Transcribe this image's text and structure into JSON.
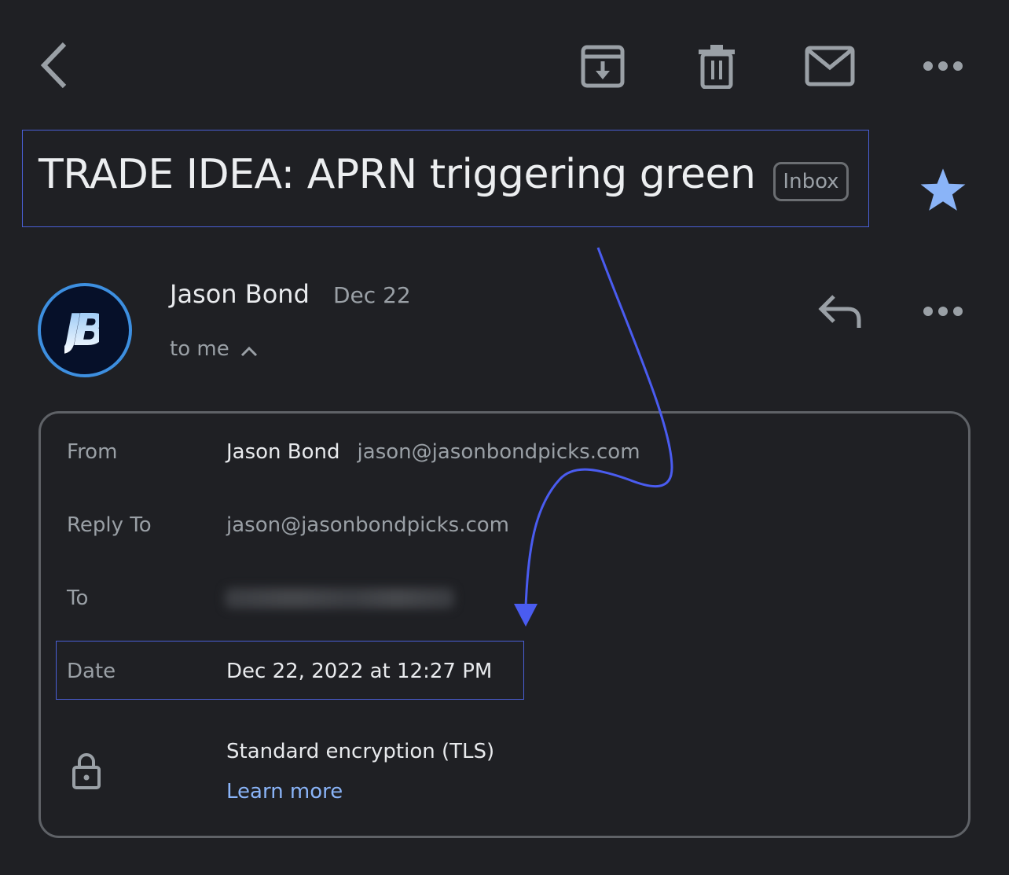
{
  "toolbar": {
    "back_icon": "chevron-left-icon",
    "archive_icon": "archive-icon",
    "delete_icon": "trash-icon",
    "mark_unread_icon": "mail-icon",
    "more_icon": "more-horizontal-icon"
  },
  "email": {
    "subject": "TRADE IDEA: APRN triggering green",
    "label": "Inbox",
    "starred": true,
    "star_color": "#8ab4f8"
  },
  "sender": {
    "avatar_initials": "JB",
    "name": "Jason Bond",
    "date_short": "Dec 22",
    "recipient_summary": "to me",
    "reply_icon": "reply-icon",
    "more_icon": "more-horizontal-icon"
  },
  "details": {
    "from_label": "From",
    "from_name": "Jason Bond",
    "from_email": "jason@jasonbondpicks.com",
    "reply_to_label": "Reply To",
    "reply_to_email": "jason@jasonbondpicks.com",
    "to_label": "To",
    "to_value_redacted": true,
    "date_label": "Date",
    "date_value": "Dec 22, 2022 at 12:27 PM",
    "security_icon": "lock-icon",
    "encryption_text": "Standard encryption (TLS)",
    "learn_more_label": "Learn more"
  },
  "annotation": {
    "highlight_color": "#4a5fd6",
    "arrow_color": "#4a5cf0"
  }
}
